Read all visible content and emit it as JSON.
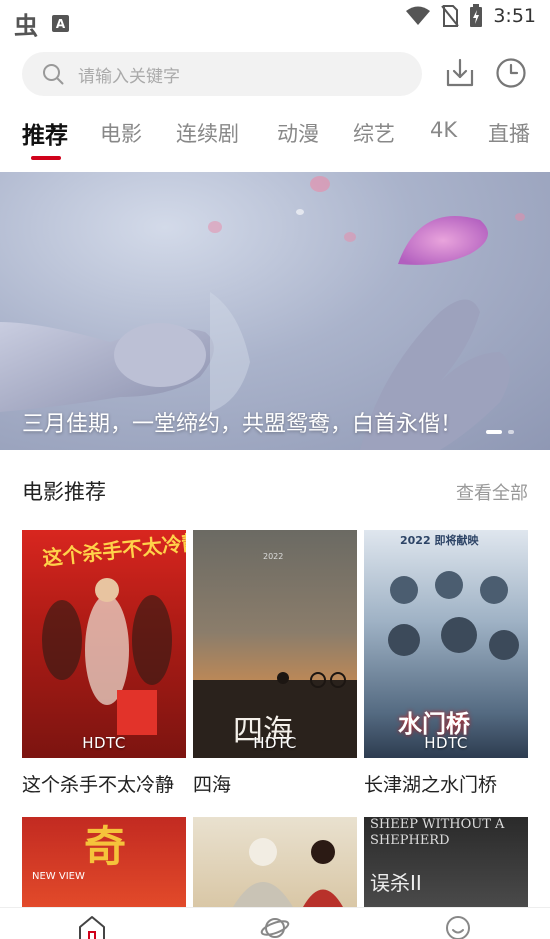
{
  "status_bar": {
    "time": "3:51",
    "left_icons": [
      "bug-app-icon",
      "a-box-icon"
    ],
    "right_icons": [
      "wifi-icon",
      "no-sim-icon",
      "battery-charging-icon"
    ],
    "bug_glyph": "虫",
    "a_box_glyph": "A"
  },
  "search": {
    "placeholder": "请输入关键字",
    "download_icon": "download-icon",
    "history_icon": "history-clock-icon"
  },
  "tabs": [
    {
      "label": "推荐",
      "active": true
    },
    {
      "label": "电影",
      "active": false
    },
    {
      "label": "连续剧",
      "active": false
    },
    {
      "label": "动漫",
      "active": false
    },
    {
      "label": "综艺",
      "active": false
    },
    {
      "label": "4K",
      "active": false
    },
    {
      "label": "直播",
      "active": false
    }
  ],
  "banner": {
    "caption": "三月佳期，一堂缔约，共盟鸳鸯，白首永偕！",
    "slide_count": 2,
    "active_slide": 1
  },
  "section": {
    "title": "电影推荐",
    "more_label": "查看全部"
  },
  "movies": [
    {
      "title": "这个杀手不太冷静",
      "quality": "HDTC",
      "poster_text": "这个杀手不太冷静"
    },
    {
      "title": "四海",
      "quality": "HDTC",
      "poster_text": "四海",
      "poster_year": "2022"
    },
    {
      "title": "长津湖之水门桥",
      "quality": "HDTC",
      "poster_text": "水门桥",
      "poster_year": "2022 即将献映"
    },
    {
      "title": "",
      "quality": "",
      "poster_text": "奇",
      "poster_sub": "NEW VIEW"
    },
    {
      "title": "",
      "quality": "",
      "poster_text": ""
    },
    {
      "title": "",
      "quality": "",
      "poster_text": "SHEEP WITHOUT A SHEPHERD",
      "poster_sub": "误杀II"
    }
  ],
  "bottom_nav": [
    {
      "icon": "home-icon",
      "active": true
    },
    {
      "icon": "planet-icon",
      "active": false
    },
    {
      "icon": "smiley-face-icon",
      "active": false
    }
  ],
  "colors": {
    "accent": "#d0021b",
    "tab_inactive": "#888888",
    "placeholder": "#aaaaaa",
    "more_link": "#999999"
  }
}
